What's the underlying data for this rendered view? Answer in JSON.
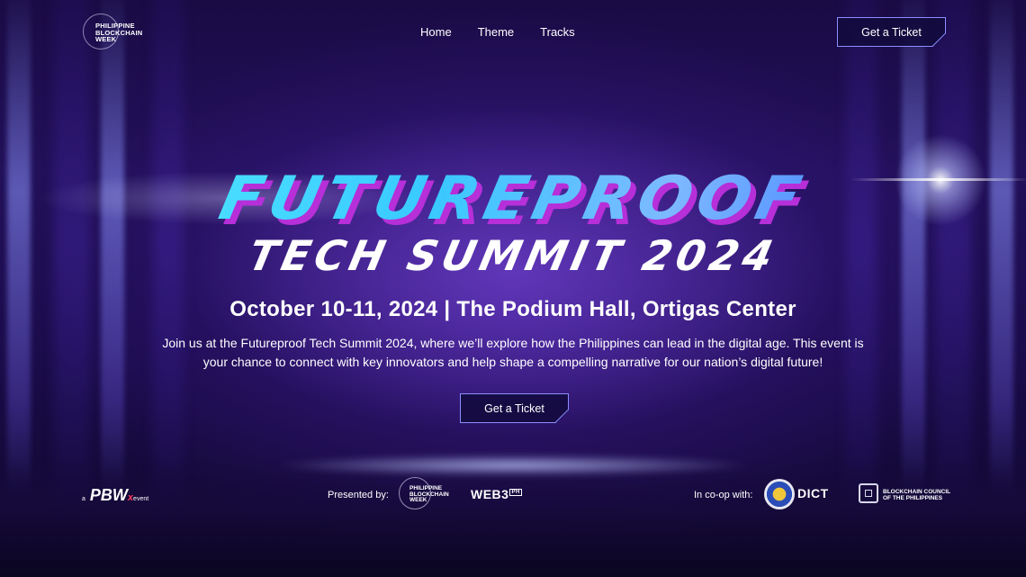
{
  "header": {
    "logo_text": "PHILIPPINE\nBLOCKCHAIN\nWEEK",
    "nav": [
      {
        "label": "Home"
      },
      {
        "label": "Theme"
      },
      {
        "label": "Tracks"
      }
    ],
    "cta_label": "Get a Ticket"
  },
  "hero": {
    "title": "FUTUREPROOF",
    "subtitle": "TECH SUMMIT 2024",
    "event_line": "October 10-11, 2024 | The Podium Hall, Ortigas Center",
    "description": "Join us at the Futureproof Tech Summit 2024, where we’ll explore how the Philippines can lead in the digital age. This event is your chance to connect with key innovators and help shape a compelling narrative for our nation’s digital future!",
    "cta_label": "Get a Ticket"
  },
  "footer": {
    "pbw_badge": {
      "prefix": "a",
      "mark": "PBW",
      "x": "x",
      "suffix": "event"
    },
    "presented_label": "Presented by:",
    "presenter_logo_text": "PHILIPPINE\nBLOCKCHAIN\nWEEK",
    "web3_label": "WEB3",
    "web3_tm": "PH",
    "coop_label": "In co-op with:",
    "dict_label": "DICT",
    "bcp_label": "BLOCKCHAIN COUNCIL\nOF THE PHILIPPINES"
  },
  "colors": {
    "background": "#1a0b45",
    "title_cyan": "#48e4ff",
    "title_magenta": "#b62fd8",
    "button_border": "#8a8fff"
  }
}
